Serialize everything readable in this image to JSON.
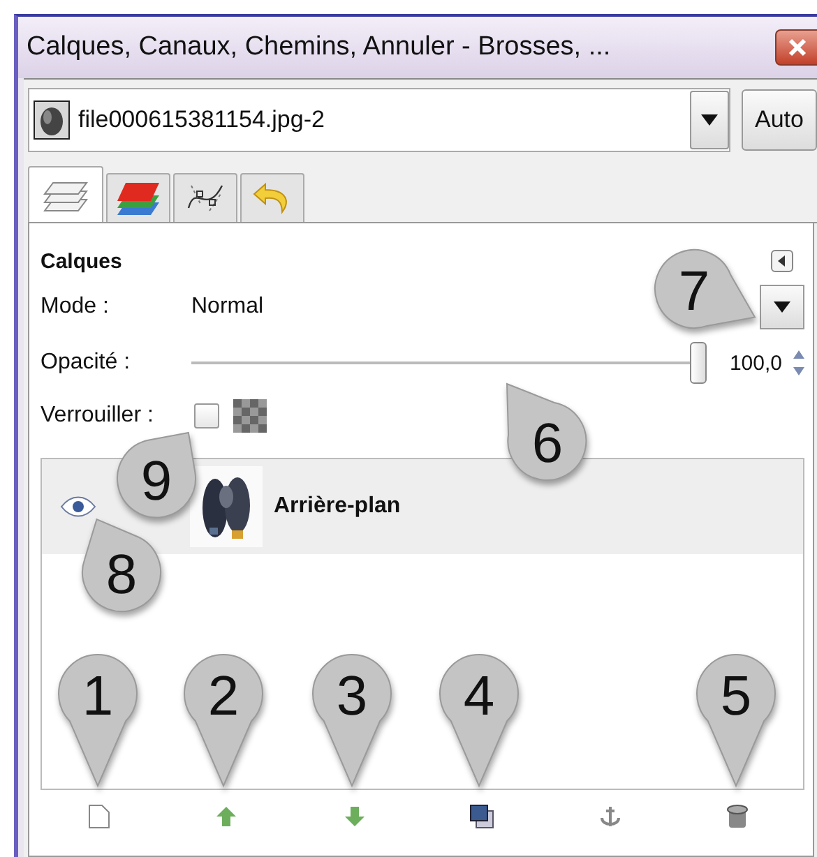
{
  "window": {
    "title": "Calques, Canaux, Chemins, Annuler - Brosses, ..."
  },
  "image_selector": {
    "value": "file000615381154.jpg-2",
    "auto_button": "Auto"
  },
  "tabs": [
    {
      "kind": "layers",
      "selected": true
    },
    {
      "kind": "channels",
      "selected": false
    },
    {
      "kind": "paths",
      "selected": false
    },
    {
      "kind": "undo",
      "selected": false
    }
  ],
  "panel": {
    "title": "Calques",
    "mode": {
      "label": "Mode :",
      "value": "Normal"
    },
    "opacity": {
      "label": "Opacité :",
      "level": 1,
      "reading": "100,0"
    },
    "lock": {
      "label": "Verrouiller :",
      "checked": false
    }
  },
  "layers": [
    {
      "name": "Arrière-plan",
      "visible": true,
      "selected": true
    }
  ],
  "bottom_buttons": [
    {
      "kind": "new"
    },
    {
      "kind": "raise"
    },
    {
      "kind": "lower"
    },
    {
      "kind": "duplicate"
    },
    {
      "kind": "anchor"
    },
    {
      "kind": "delete"
    }
  ],
  "annotations": [
    {
      "label": "1"
    },
    {
      "label": "2"
    },
    {
      "label": "3"
    },
    {
      "label": "4"
    },
    {
      "label": "5"
    },
    {
      "label": "6"
    },
    {
      "label": "7"
    },
    {
      "label": "8"
    },
    {
      "label": "9"
    }
  ]
}
